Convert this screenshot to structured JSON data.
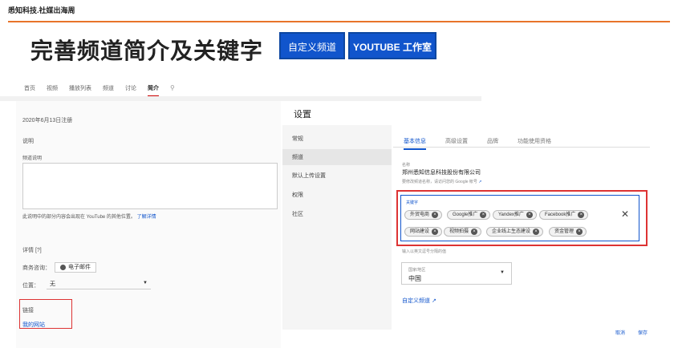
{
  "brand": "悉知科技.社媒出海周",
  "hero": {
    "title": "完善频道简介及关键字",
    "btn_custom": "自定义频道",
    "btn_studio": "YOUTUBE 工作室"
  },
  "channel_tabs": [
    "首页",
    "视频",
    "播放列表",
    "频道",
    "讨论",
    "简介"
  ],
  "left": {
    "joined": "2020年6月13日注册",
    "description_heading": "说明",
    "description_label": "频道说明",
    "notice": "此说明中的部分内容会出现在 YouTube 的其他位置。",
    "notice_link": "了解详情",
    "details_heading": "详情 [?]",
    "business_label": "商务咨询：",
    "email_button": "电子邮件",
    "location_label": "位置：",
    "location_value": "无",
    "links_heading": "链接",
    "my_site": "我的网站"
  },
  "settings": {
    "title": "设置",
    "sidebar": [
      "常规",
      "频道",
      "默认上传设置",
      "权限",
      "社区"
    ],
    "active_side": "频道",
    "tabs": [
      "基本信息",
      "高级设置",
      "品牌",
      "功能使用资格"
    ],
    "active_tab": "基本信息",
    "name_label": "名称",
    "name_value": "郑州悉知信息科技股份有限公司",
    "name_hint": "要修改频道名称，请访问您的 Google 帐号",
    "keywords_label": "关键字",
    "keywords": [
      "外贸电商",
      "Google推广",
      "Yandex推广",
      "Facebook推广",
      "网站建设",
      "视频拍摄",
      "企业线上生态建设",
      "资金管理"
    ],
    "keywords_hint": "输入以英文逗号分隔的值",
    "region_label": "国家/地区",
    "region_value": "中国",
    "custom_channel_link": "自定义频道",
    "cancel": "取消",
    "save": "保存"
  },
  "colors": {
    "accent": "#1155cc",
    "highlight": "#dd3333",
    "brand_line": "#e8742a"
  }
}
